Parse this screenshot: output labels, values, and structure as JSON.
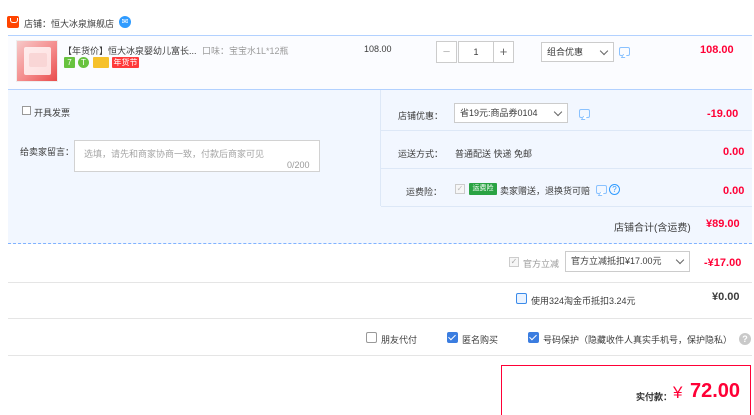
{
  "shop": {
    "label": "店铺：",
    "name": "恒大冰泉旗舰店"
  },
  "item": {
    "title": "【年货价】恒大冰泉婴幼儿富长...",
    "sku": "口味：宝宝水1L*12瓶",
    "badges": [
      "7",
      "T",
      "",
      "年货节"
    ],
    "unit_price": "108.00",
    "quantity": "1",
    "minus": "−",
    "plus": "+",
    "promo_select": "组合优惠",
    "total": "108.00"
  },
  "options": {
    "invoice_label": "开具发票",
    "message_label": "给卖家留言：",
    "message_placeholder": "选填，请先和商家协商一致，付款后商家可见",
    "message_count": "0/200",
    "shop_coupon_label": "店铺优惠：",
    "shop_coupon_select": "省19元:商品券0104",
    "shop_coupon_value": "-19.00",
    "shipping_label": "运送方式：",
    "shipping_text": "普通配送 快递 免邮",
    "shipping_value": "0.00",
    "insurance_label": "运费险：",
    "insurance_logo": "运费险",
    "insurance_text": "卖家赠送，退换货可赔",
    "insurance_value": "0.00",
    "shop_total_label": "店铺合计(含运费)",
    "shop_total_value": "¥89.00"
  },
  "discounts": {
    "tmall_label": "官方立减",
    "tmall_select": "官方立减抵扣¥17.00元",
    "tmall_value": "-¥17.00",
    "coin_label": "使用324淘金币抵扣3.24元",
    "coin_value": "¥0.00"
  },
  "privacy": {
    "friend_pay": "朋友代付",
    "anonymous": "匿名购买",
    "number_protect": "号码保护（隐藏收件人真实手机号，保护隐私）",
    "help": "?"
  },
  "pay": {
    "label": "实付款：",
    "currency": "¥",
    "amount": "72.00"
  },
  "colors": {
    "accent": "#ff0036",
    "link": "#3b7de0",
    "panel": "#f2f7ff"
  }
}
